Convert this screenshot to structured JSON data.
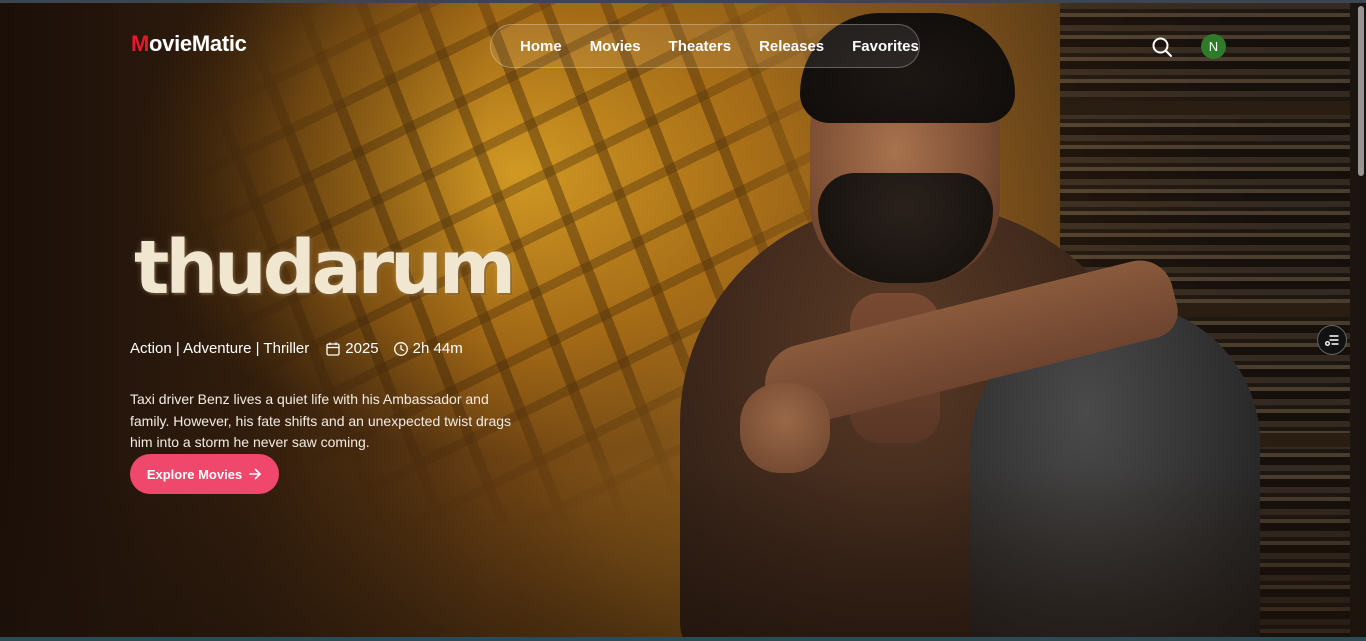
{
  "brand": {
    "first_letter": "M",
    "rest": "ovieMatic"
  },
  "nav": {
    "items": [
      "Home",
      "Movies",
      "Theaters",
      "Releases",
      "Favorites"
    ]
  },
  "user": {
    "avatar_initial": "N"
  },
  "hero": {
    "title": "thudarum",
    "genres": "Action | Adventure | Thriller",
    "year": "2025",
    "duration": "2h 44m",
    "description": "Taxi driver Benz lives a quiet life with his Ambassador and family. However, his fate shifts and an unexpected twist drags him into a storm he never saw coming.",
    "cta_label": "Explore Movies"
  },
  "icons": {
    "search": "search-icon",
    "calendar": "calendar-icon",
    "clock": "clock-icon",
    "arrow": "arrow-right-icon",
    "filter": "filter-list-icon"
  },
  "colors": {
    "brand_accent": "#e8182e",
    "cta": "#f0476c",
    "avatar": "#2f7a2b"
  }
}
